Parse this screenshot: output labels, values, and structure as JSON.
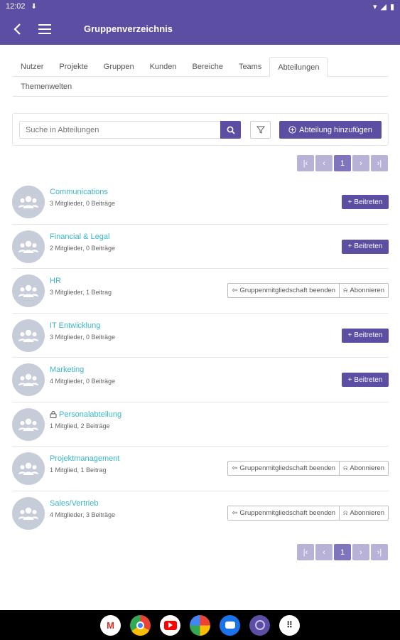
{
  "status": {
    "time": "12:02"
  },
  "appbar": {
    "title": "Gruppenverzeichnis"
  },
  "tabs": [
    "Nutzer",
    "Projekte",
    "Gruppen",
    "Kunden",
    "Bereiche",
    "Teams",
    "Abteilungen"
  ],
  "tab_row2": "Themenwelten",
  "active_tab": "Abteilungen",
  "search": {
    "placeholder": "Suche in Abteilungen"
  },
  "add_button": "Abteilung hinzufügen",
  "pagination": {
    "current": "1"
  },
  "groups": [
    {
      "name": "Communications",
      "meta": "3 Mitglieder, 0 Beiträge",
      "action": "join",
      "locked": false
    },
    {
      "name": "Financial & Legal",
      "meta": "2 Mitglieder, 0 Beiträge",
      "action": "join",
      "locked": false
    },
    {
      "name": "HR",
      "meta": "3 Mitglieder, 1 Beitrag",
      "action": "member",
      "locked": false
    },
    {
      "name": "IT Entwicklung",
      "meta": "3 Mitglieder, 0 Beiträge",
      "action": "join",
      "locked": false
    },
    {
      "name": "Marketing",
      "meta": "4 Mitglieder, 0 Beiträge",
      "action": "join",
      "locked": false
    },
    {
      "name": "Personalabteilung",
      "meta": "1 Mitglied, 2 Beiträge",
      "action": "none",
      "locked": true
    },
    {
      "name": "Projektmanagement",
      "meta": "1 Mitglied, 1 Beitrag",
      "action": "member",
      "locked": false
    },
    {
      "name": "Sales/Vertrieb",
      "meta": "4 Mitglieder, 3 Beiträge",
      "action": "member",
      "locked": false
    }
  ],
  "labels": {
    "join": "Beitreten",
    "leave": "Gruppenmitgliedschaft beenden",
    "subscribe": "Abonnieren"
  },
  "colors": {
    "primary": "#5b4ea3",
    "link": "#39b6c9",
    "avatar": "#c7ccd9"
  },
  "dock_apps": [
    "gmail-icon",
    "chrome-icon",
    "youtube-icon",
    "photos-icon",
    "messages-icon",
    "app-icon",
    "apps-grid-icon"
  ]
}
